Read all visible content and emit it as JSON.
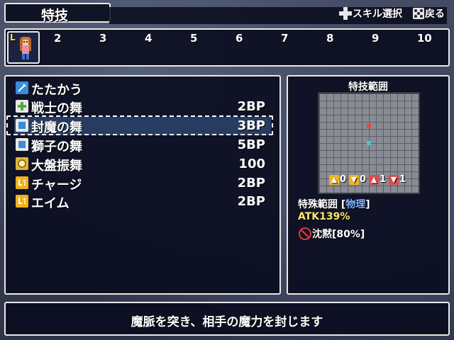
{
  "header": {
    "title": "特技"
  },
  "hints": {
    "skill_select": "スキル選択",
    "back": "戻る"
  },
  "party": {
    "slot_numbers": [
      "2",
      "3",
      "4",
      "5",
      "6",
      "7",
      "8",
      "9",
      "10"
    ],
    "leader_mark": "L"
  },
  "skills": [
    {
      "name": "たたかう",
      "cost": "",
      "icon": "sword-icon",
      "color": "#3b8bd9"
    },
    {
      "name": "戦士の舞",
      "cost": "2BP",
      "icon": "plus-icon",
      "color": "#6cc24a"
    },
    {
      "name": "封魔の舞",
      "cost": "3BP",
      "icon": "square-icon",
      "color": "#3b8bd9"
    },
    {
      "name": "獅子の舞",
      "cost": "5BP",
      "icon": "square-icon",
      "color": "#3b8bd9"
    },
    {
      "name": "大盤振舞",
      "cost": "100",
      "icon": "coin-icon",
      "color": "#e0b43a"
    },
    {
      "name": "チャージ",
      "cost": "2BP",
      "icon": "charge-icon",
      "color": "#f0b21e"
    },
    {
      "name": "エイム",
      "cost": "2BP",
      "icon": "charge-icon",
      "color": "#f0b21e"
    }
  ],
  "selected_index": 2,
  "range_panel": {
    "title": "特技範囲",
    "arrows": [
      {
        "value": "0",
        "color": "#f0b21e"
      },
      {
        "value": "0",
        "color": "#f0b21e"
      },
      {
        "value": "1",
        "color": "#e04848"
      },
      {
        "value": "1",
        "color": "#e04848"
      }
    ],
    "special_label": "特殊範囲",
    "special_type": "物理",
    "atk": "ATK139%",
    "status": "沈黙[80%]"
  },
  "description": "魔脈を突き、相手の魔力を封じます"
}
